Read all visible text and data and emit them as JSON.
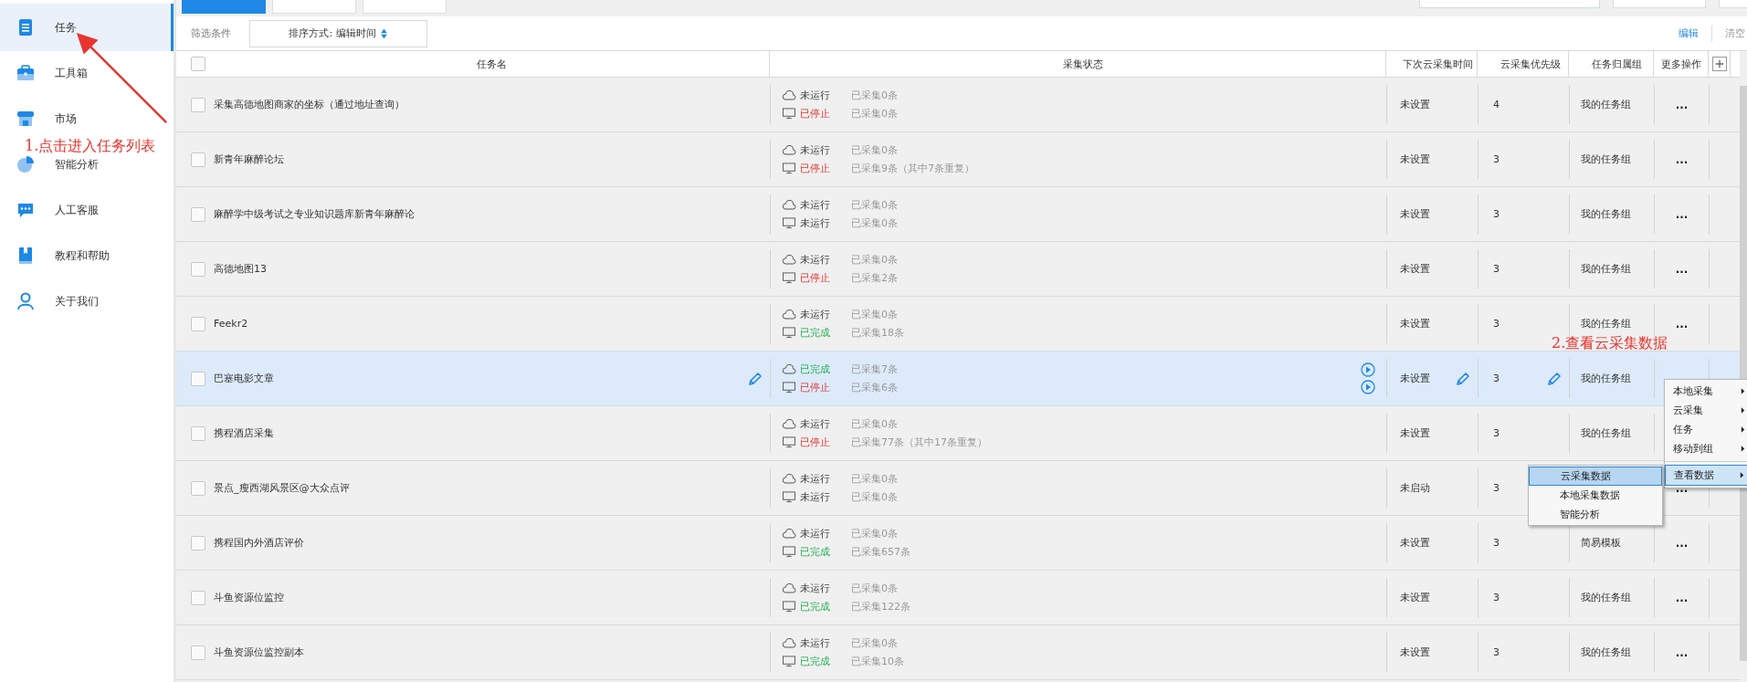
{
  "sidebar": {
    "items": [
      {
        "label": "任务",
        "selected": true,
        "kind": "doc"
      },
      {
        "label": "工具箱",
        "selected": false,
        "kind": "toolbox"
      },
      {
        "label": "市场",
        "selected": false,
        "kind": "store"
      },
      {
        "label": "智能分析",
        "selected": false,
        "kind": "pie"
      },
      {
        "label": "人工客服",
        "selected": false,
        "kind": "chat"
      },
      {
        "label": "教程和帮助",
        "selected": false,
        "kind": "book"
      },
      {
        "label": "关于我们",
        "selected": false,
        "kind": "user"
      }
    ]
  },
  "top_tabs": [
    {
      "selected": true
    },
    {
      "selected": false
    },
    {
      "selected": false
    }
  ],
  "toolbar": {
    "filter_label": "筛选条件",
    "sort": "排序方式: 编辑时间",
    "edit": "编辑",
    "clear": "清空"
  },
  "table": {
    "select_all": {
      "checked": false
    },
    "columns": [
      "任务名",
      "采集状态",
      "下次云采集时间",
      "云采集优先级",
      "任务归属组",
      "更多操作"
    ],
    "rows": [
      {
        "name": "采集高德地图商家的坐标（通过地址查询）",
        "checked": false,
        "selected": false,
        "cloud": {
          "status": "未运行",
          "kind": "idle",
          "count": "已采集0条"
        },
        "local": {
          "status": "已停止",
          "kind": "stopped",
          "count": "已采集0条"
        },
        "next_time": "未设置",
        "priority": "4",
        "group": "我的任务组",
        "more": "..."
      },
      {
        "name": "新青年麻醉论坛",
        "checked": false,
        "selected": false,
        "cloud": {
          "status": "未运行",
          "kind": "idle",
          "count": "已采集0条"
        },
        "local": {
          "status": "已停止",
          "kind": "stopped",
          "count": "已采集9条（其中7条重复）"
        },
        "next_time": "未设置",
        "priority": "3",
        "group": "我的任务组",
        "more": "..."
      },
      {
        "name": "麻醉学中级考试之专业知识题库新青年麻醉论",
        "checked": false,
        "selected": false,
        "cloud": {
          "status": "未运行",
          "kind": "idle",
          "count": "已采集0条"
        },
        "local": {
          "status": "未运行",
          "kind": "idle",
          "count": "已采集0条"
        },
        "next_time": "未设置",
        "priority": "3",
        "group": "我的任务组",
        "more": "..."
      },
      {
        "name": "高德地图13",
        "checked": false,
        "selected": false,
        "cloud": {
          "status": "未运行",
          "kind": "idle",
          "count": "已采集0条"
        },
        "local": {
          "status": "已停止",
          "kind": "stopped",
          "count": "已采集2条"
        },
        "next_time": "未设置",
        "priority": "3",
        "group": "我的任务组",
        "more": "..."
      },
      {
        "name": "Feekr2",
        "checked": false,
        "selected": false,
        "cloud": {
          "status": "未运行",
          "kind": "idle",
          "count": "已采集0条"
        },
        "local": {
          "status": "已完成",
          "kind": "done",
          "count": "已采集18条"
        },
        "next_time": "未设置",
        "priority": "3",
        "group": "我的任务组",
        "more": "..."
      },
      {
        "name": "巴塞电影文章",
        "checked": false,
        "selected": true,
        "cloud": {
          "status": "已完成",
          "kind": "done",
          "count": "已采集7条"
        },
        "local": {
          "status": "已停止",
          "kind": "stopped",
          "count": "已采集6条"
        },
        "next_time": "未设置",
        "priority": "3",
        "group": "我的任务组"
      },
      {
        "name": "携程酒店采集",
        "checked": false,
        "selected": false,
        "cloud": {
          "status": "未运行",
          "kind": "idle",
          "count": "已采集0条"
        },
        "local": {
          "status": "已停止",
          "kind": "stopped",
          "count": "已采集77条（其中17条重复）"
        },
        "next_time": "未设置",
        "priority": "3",
        "group": "我的任务组"
      },
      {
        "name": "景点_瘦西湖风景区@大众点评",
        "checked": false,
        "selected": false,
        "cloud": {
          "status": "未运行",
          "kind": "idle",
          "count": "已采集0条"
        },
        "local": {
          "status": "未运行",
          "kind": "idle",
          "count": "已采集0条"
        },
        "next_time": "未启动",
        "priority": "3",
        "more": "..."
      },
      {
        "name": "携程国内外酒店评价",
        "checked": false,
        "selected": false,
        "cloud": {
          "status": "未运行",
          "kind": "idle",
          "count": "已采集0条"
        },
        "local": {
          "status": "已完成",
          "kind": "done",
          "count": "已采集657条"
        },
        "next_time": "未设置",
        "priority": "3",
        "group": "简易模板",
        "more": "..."
      },
      {
        "name": "斗鱼资源位监控",
        "checked": false,
        "selected": false,
        "cloud": {
          "status": "未运行",
          "kind": "idle",
          "count": "已采集0条"
        },
        "local": {
          "status": "已完成",
          "kind": "done",
          "count": "已采集122条"
        },
        "next_time": "未设置",
        "priority": "3",
        "group": "我的任务组",
        "more": "..."
      },
      {
        "name": "斗鱼资源位监控副本",
        "checked": false,
        "selected": false,
        "cloud": {
          "status": "未运行",
          "kind": "idle",
          "count": "已采集0条"
        },
        "local": {
          "status": "已完成",
          "kind": "done",
          "count": "已采集10条"
        },
        "next_time": "未设置",
        "priority": "3",
        "group": "我的任务组",
        "more": "..."
      }
    ]
  },
  "context_menu": {
    "items": [
      {
        "label": "本地采集",
        "selected": false
      },
      {
        "label": "云采集",
        "selected": false
      },
      {
        "label": "任务",
        "selected": false
      },
      {
        "label": "移动到组",
        "selected": false
      },
      {
        "label": "查看数据",
        "selected": true
      }
    ]
  },
  "submenu": {
    "items": [
      {
        "label": "云采集数据",
        "selected": true
      },
      {
        "label": "本地采集数据",
        "selected": false
      },
      {
        "label": "智能分析",
        "selected": false
      }
    ]
  },
  "annotations": [
    {
      "text": "1.点击进入任务列表"
    },
    {
      "text": "2.查看云采集数据"
    }
  ]
}
